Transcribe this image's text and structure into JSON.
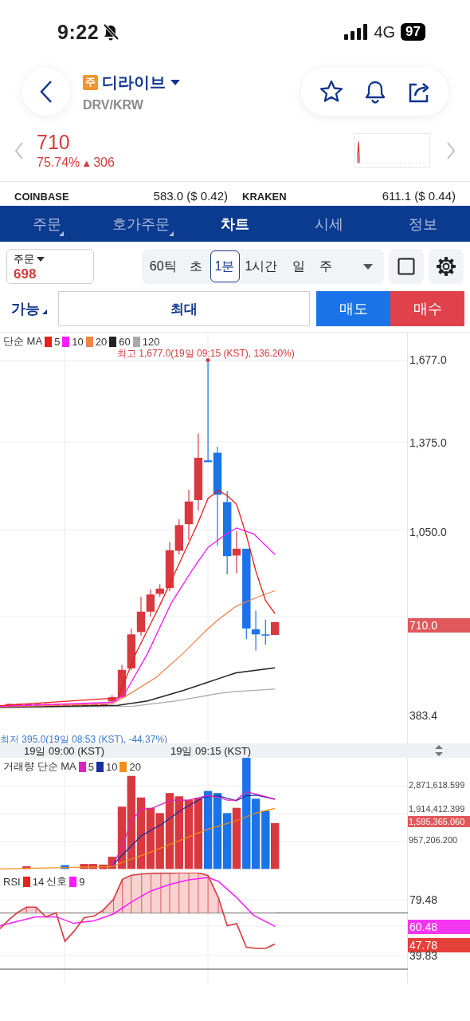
{
  "status_bar": {
    "time": "9:22",
    "network": "4G",
    "battery": "97"
  },
  "header": {
    "badge": "주",
    "name": "디라이브",
    "pair": "DRV/KRW"
  },
  "price": {
    "value": "710",
    "change_pct": "75.74%",
    "arrow": "▲",
    "change": "306"
  },
  "exchanges": [
    {
      "name": "COINBASE",
      "price": "583.0 ($ 0.42)"
    },
    {
      "name": "KRAKEN",
      "price": "611.1 ($ 0.44)"
    }
  ],
  "tabs": [
    {
      "label": "주문",
      "has_menu": true,
      "selected": false
    },
    {
      "label": "호가주문",
      "has_menu": true,
      "selected": false
    },
    {
      "label": "차트",
      "has_menu": false,
      "selected": true
    },
    {
      "label": "시세",
      "has_menu": false,
      "selected": false
    },
    {
      "label": "정보",
      "has_menu": false,
      "selected": false
    }
  ],
  "order_box": {
    "label": "주문",
    "value": "698"
  },
  "intervals": [
    {
      "label": "60틱",
      "selected": false
    },
    {
      "label": "초",
      "selected": false
    },
    {
      "label": "1분",
      "selected": true
    },
    {
      "label": "1시간",
      "selected": false
    },
    {
      "label": "일",
      "selected": false
    },
    {
      "label": "주",
      "selected": false
    }
  ],
  "available": {
    "label": "가능"
  },
  "quantity": {
    "value": "최대"
  },
  "buttons": [
    {
      "label": "매도",
      "kind": "sell"
    },
    {
      "label": "매수",
      "kind": "buy"
    }
  ],
  "price_chart": {
    "legend": [
      {
        "kind": "text",
        "text": "단순 MA"
      },
      {
        "kind": "swatch",
        "color": "#e8201e"
      },
      {
        "kind": "text",
        "text": "5"
      },
      {
        "kind": "swatch",
        "color": "#ff1aff"
      },
      {
        "kind": "text",
        "text": "10"
      },
      {
        "kind": "swatch",
        "color": "#f0834a"
      },
      {
        "kind": "text",
        "text": "20"
      },
      {
        "kind": "swatch",
        "color": "#222222"
      },
      {
        "kind": "text",
        "text": "60"
      },
      {
        "kind": "swatch",
        "color": "#aaaaaa"
      },
      {
        "kind": "text",
        "text": "120"
      }
    ],
    "high_label": "최고 1,677.0(19일 09:15 (KST), 136.20%)",
    "low_label": "최저 395.0(19일 08:53 (KST), -44.37%)",
    "axis": [
      {
        "label": "1,677.0",
        "kind": "tick"
      },
      {
        "label": "1,375.0",
        "kind": "tick"
      },
      {
        "label": "1,050.0",
        "kind": "tick"
      },
      {
        "label": "710.0",
        "kind": "badge",
        "color": "#e0585b"
      },
      {
        "label": "383.4",
        "kind": "tick"
      }
    ]
  },
  "time_axis": [
    "19일 09:00 (KST)",
    "19일 09:15 (KST)"
  ],
  "volume_chart": {
    "legend": [
      {
        "kind": "text",
        "text": "거래량 단순 MA"
      },
      {
        "kind": "swatch",
        "color": "#e020c0"
      },
      {
        "kind": "text",
        "text": "5"
      },
      {
        "kind": "swatch",
        "color": "#1a2fa0"
      },
      {
        "kind": "text",
        "text": "10"
      },
      {
        "kind": "swatch",
        "color": "#f0901a"
      },
      {
        "kind": "text",
        "text": "20"
      }
    ],
    "axis": [
      {
        "label": "2,871,618.599",
        "kind": "tick"
      },
      {
        "label": "1,914,412.399",
        "kind": "tick"
      },
      {
        "label": "1,595,365.060",
        "kind": "badge",
        "color": "#e0585b"
      },
      {
        "label": "957,206.200",
        "kind": "tick"
      }
    ]
  },
  "rsi_chart": {
    "legend": [
      {
        "kind": "text",
        "text": "RSI"
      },
      {
        "kind": "swatch",
        "color": "#e52420"
      },
      {
        "kind": "text",
        "text": "14"
      },
      {
        "kind": "text",
        "text": "신호"
      },
      {
        "kind": "swatch",
        "color": "#ff1aff"
      },
      {
        "kind": "text",
        "text": "9"
      }
    ],
    "axis": [
      {
        "label": "79.48",
        "kind": "tick"
      },
      {
        "label": "60.48",
        "kind": "badge",
        "color": "#f536f0"
      },
      {
        "label": "47.78",
        "kind": "badge",
        "color": "#e5403a"
      },
      {
        "label": "39.83",
        "kind": "tick"
      }
    ]
  }
}
